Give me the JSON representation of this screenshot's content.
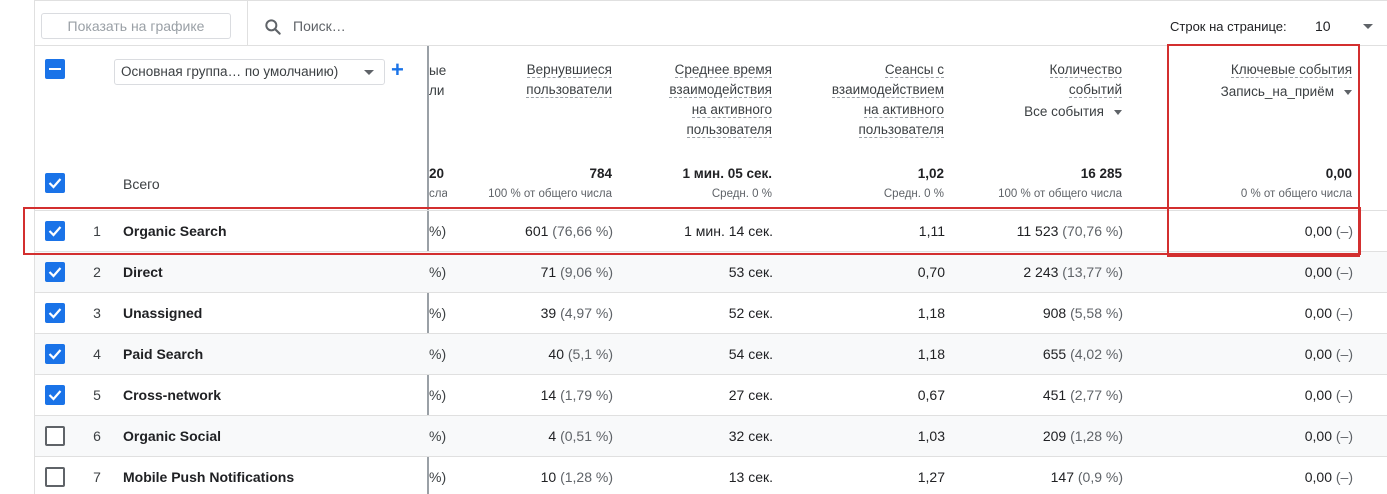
{
  "toolbar": {
    "plot_button": "Показать на графике",
    "search_placeholder": "Поиск…",
    "rows_label": "Строк на странице:",
    "rows_value": "10"
  },
  "dimension": {
    "selector": "Основная группа… по умолчанию)",
    "add_icon": "plus-icon"
  },
  "headers": {
    "cut": [
      "ые",
      "ли"
    ],
    "returning": [
      "Вернувшиеся",
      "пользователи"
    ],
    "avg_time": [
      "Среднее время",
      "взаимодействия",
      "на активного",
      "пользователя"
    ],
    "sessions": [
      "Сеансы с",
      "взаимодействием",
      "на активного",
      "пользователя"
    ],
    "events": [
      "Количество",
      "событий"
    ],
    "events_filter": "Все события",
    "key_events": "Ключевые события",
    "key_events_filter": "Запись_на_приём"
  },
  "totals": {
    "label": "Всего",
    "cut": "20",
    "cut_sub": "сла",
    "returning": "784",
    "returning_sub": "100 % от общего числа",
    "avg_time": "1 мин. 05 сек.",
    "avg_time_sub": "Средн. 0 %",
    "sessions": "1,02",
    "sessions_sub": "Средн. 0 %",
    "events": "16 285",
    "events_sub": "100 % от общего числа",
    "key_events": "0,00",
    "key_events_sub": "0 % от общего числа"
  },
  "rows": [
    {
      "idx": "1",
      "name": "Organic Search",
      "cut": "%)",
      "returning": "601",
      "returning_pct": "(76,66 %)",
      "avg_time": "1 мин. 14 сек.",
      "sessions": "1,11",
      "events": "11 523",
      "events_pct": "(70,76 %)",
      "key": "0,00",
      "key_pct": "(–)",
      "checked": true
    },
    {
      "idx": "2",
      "name": "Direct",
      "cut": "%)",
      "returning": "71",
      "returning_pct": "(9,06 %)",
      "avg_time": "53 сек.",
      "sessions": "0,70",
      "events": "2 243",
      "events_pct": "(13,77 %)",
      "key": "0,00",
      "key_pct": "(–)",
      "checked": true
    },
    {
      "idx": "3",
      "name": "Unassigned",
      "cut": "%)",
      "returning": "39",
      "returning_pct": "(4,97 %)",
      "avg_time": "52 сек.",
      "sessions": "1,18",
      "events": "908",
      "events_pct": "(5,58 %)",
      "key": "0,00",
      "key_pct": "(–)",
      "checked": true
    },
    {
      "idx": "4",
      "name": "Paid Search",
      "cut": "%)",
      "returning": "40",
      "returning_pct": "(5,1 %)",
      "avg_time": "54 сек.",
      "sessions": "1,18",
      "events": "655",
      "events_pct": "(4,02 %)",
      "key": "0,00",
      "key_pct": "(–)",
      "checked": true
    },
    {
      "idx": "5",
      "name": "Cross-network",
      "cut": "%)",
      "returning": "14",
      "returning_pct": "(1,79 %)",
      "avg_time": "27 сек.",
      "sessions": "0,67",
      "events": "451",
      "events_pct": "(2,77 %)",
      "key": "0,00",
      "key_pct": "(–)",
      "checked": true
    },
    {
      "idx": "6",
      "name": "Organic Social",
      "cut": "%)",
      "returning": "4",
      "returning_pct": "(0,51 %)",
      "avg_time": "32 сек.",
      "sessions": "1,03",
      "events": "209",
      "events_pct": "(1,28 %)",
      "key": "0,00",
      "key_pct": "(–)",
      "checked": false
    },
    {
      "idx": "7",
      "name": "Mobile Push Notifications",
      "cut": "%)",
      "returning": "10",
      "returning_pct": "(1,28 %)",
      "avg_time": "13 сек.",
      "sessions": "1,27",
      "events": "147",
      "events_pct": "(0,9 %)",
      "key": "0,00",
      "key_pct": "(–)",
      "checked": false
    }
  ],
  "colors": {
    "accent": "#1a73e8",
    "annotation": "#d32f2f"
  }
}
